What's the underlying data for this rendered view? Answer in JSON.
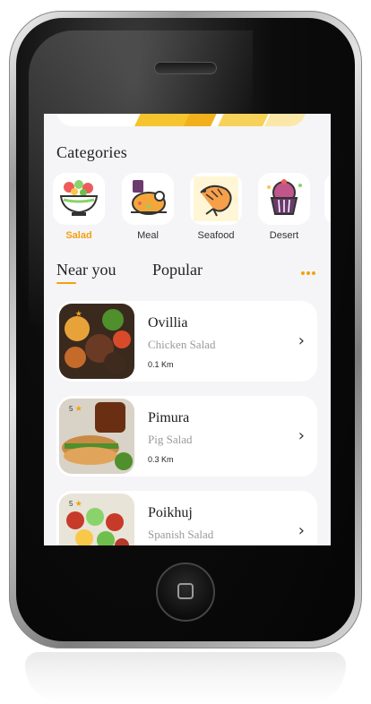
{
  "categories_title": "Categories",
  "categories": [
    {
      "label": "Salad",
      "icon": "salad-bowl-icon",
      "active": true
    },
    {
      "label": "Meal",
      "icon": "roast-chicken-icon",
      "active": false
    },
    {
      "label": "Seafood",
      "icon": "shrimp-icon",
      "active": false
    },
    {
      "label": "Desert",
      "icon": "cupcake-icon",
      "active": false
    }
  ],
  "tabs": [
    {
      "label": "Near you",
      "active": true
    },
    {
      "label": "Popular",
      "active": false
    }
  ],
  "more_icon": "more-dots-icon",
  "restaurants": [
    {
      "rating": "5",
      "name": "Ovillia",
      "dish": "Chicken Salad",
      "distance": "0.1 Km"
    },
    {
      "rating": "5",
      "name": "Pimura",
      "dish": "Pig Salad",
      "distance": "0.3 Km"
    },
    {
      "rating": "5",
      "name": "Poikhuj",
      "dish": "Spanish Salad",
      "distance": ""
    }
  ],
  "colors": {
    "accent": "#f3a10f",
    "screen_bg": "#f5f5f8",
    "card_bg": "#ffffff"
  }
}
